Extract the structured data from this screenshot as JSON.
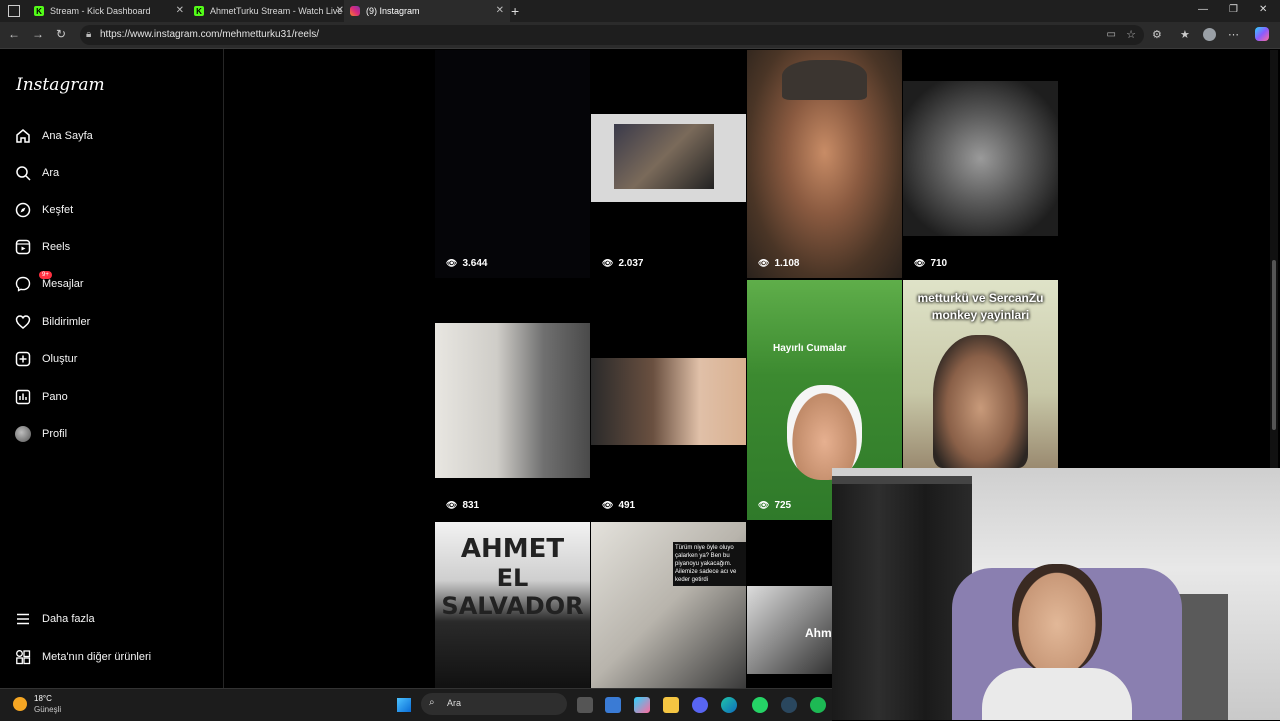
{
  "browser": {
    "tabs": [
      {
        "title": "Stream - Kick Dashboard",
        "favicon": "kick-icon"
      },
      {
        "title": "AhmetTurku Stream - Watch Live",
        "favicon": "kick-icon"
      },
      {
        "title": "(9) Instagram",
        "favicon": "instagram-icon",
        "active": true
      }
    ],
    "url": "https://www.instagram.com/mehmetturku31/reels/",
    "favicon_letter": "K"
  },
  "sidebar": {
    "logo": "Instagram",
    "items": [
      {
        "label": "Ana Sayfa",
        "icon": "home-icon"
      },
      {
        "label": "Ara",
        "icon": "search-icon"
      },
      {
        "label": "Keşfet",
        "icon": "compass-icon"
      },
      {
        "label": "Reels",
        "icon": "reels-icon"
      },
      {
        "label": "Mesajlar",
        "icon": "messenger-icon",
        "badge": "9+"
      },
      {
        "label": "Bildirimler",
        "icon": "heart-icon"
      },
      {
        "label": "Oluştur",
        "icon": "plus-square-icon"
      },
      {
        "label": "Pano",
        "icon": "chart-icon"
      },
      {
        "label": "Profil",
        "icon": "avatar-icon"
      }
    ],
    "bottom": [
      {
        "label": "Daha fazla",
        "icon": "menu-icon"
      },
      {
        "label": "Meta'nın diğer ürünleri",
        "icon": "grid-icon"
      }
    ]
  },
  "reels": {
    "row1": [
      {
        "views": "3.644",
        "overlay": ""
      },
      {
        "views": "2.037",
        "overlay": ""
      },
      {
        "views": "1.108",
        "overlay": ""
      },
      {
        "views": "710",
        "overlay": ""
      }
    ],
    "row2": [
      {
        "views": "831",
        "overlay": ""
      },
      {
        "views": "491",
        "overlay": ""
      },
      {
        "views": "725",
        "overlay": "Hayırlı Cumalar"
      },
      {
        "views": "",
        "overlay": "metturkü ve SercanZu monkey yayinlari"
      }
    ],
    "row3": [
      {
        "overlay1": "AHMET",
        "overlay2": "EL SALVADOR"
      },
      {
        "overlay": "Türüm niye öyle oluyo çalarken ya? Ben bu piyanoyu yakacağım. Ailemize sadece acı ve keder getirdi"
      },
      {
        "overlay": "Ahm"
      }
    ]
  },
  "taskbar": {
    "weather_temp": "18°C",
    "weather_desc": "Güneşli",
    "search_placeholder": "Ara"
  },
  "colors": {
    "background": "#000000",
    "badge": "#ff3040",
    "kick_green": "#53fc18"
  }
}
